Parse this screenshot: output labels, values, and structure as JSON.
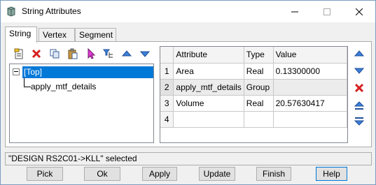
{
  "window": {
    "title": "String Attributes",
    "icons": [
      "string-app-icon",
      "minimize-icon",
      "maximize-icon",
      "close-icon"
    ]
  },
  "tabs": [
    {
      "label": "String",
      "active": true
    },
    {
      "label": "Vertex",
      "active": false
    },
    {
      "label": "Segment",
      "active": false
    }
  ],
  "tree_toolbar": [
    "new-attribute-icon",
    "delete-icon",
    "copy-icon",
    "paste-icon",
    "select-icon",
    "tree-filter-icon",
    "move-up-icon",
    "move-down-icon"
  ],
  "tree": {
    "root": "[Top]",
    "children": [
      "apply_mtf_details"
    ]
  },
  "grid": {
    "headers": [
      "Attribute",
      "Type",
      "Value"
    ],
    "rows": [
      {
        "num": "1",
        "attribute": "Area",
        "type": "Real",
        "value": "0.13300000"
      },
      {
        "num": "2",
        "attribute": "apply_mtf_details",
        "type": "Group",
        "value": ""
      },
      {
        "num": "3",
        "attribute": "Volume",
        "type": "Real",
        "value": "20.57630417"
      },
      {
        "num": "4",
        "attribute": "",
        "type": "",
        "value": ""
      }
    ]
  },
  "right_toolbar": [
    "move-row-up-icon",
    "move-row-down-icon",
    "delete-row-icon",
    "move-row-top-icon",
    "move-row-bottom-icon"
  ],
  "status": "\"DESIGN RS2C01->KLL\" selected",
  "buttons": {
    "pick": "Pick",
    "ok": "Ok",
    "apply": "Apply",
    "update": "Update",
    "finish": "Finish",
    "help": "Help"
  },
  "colors": {
    "selection": "#0078d7",
    "accent_blue": "#3b7fd8",
    "delete_red": "#d62020"
  }
}
